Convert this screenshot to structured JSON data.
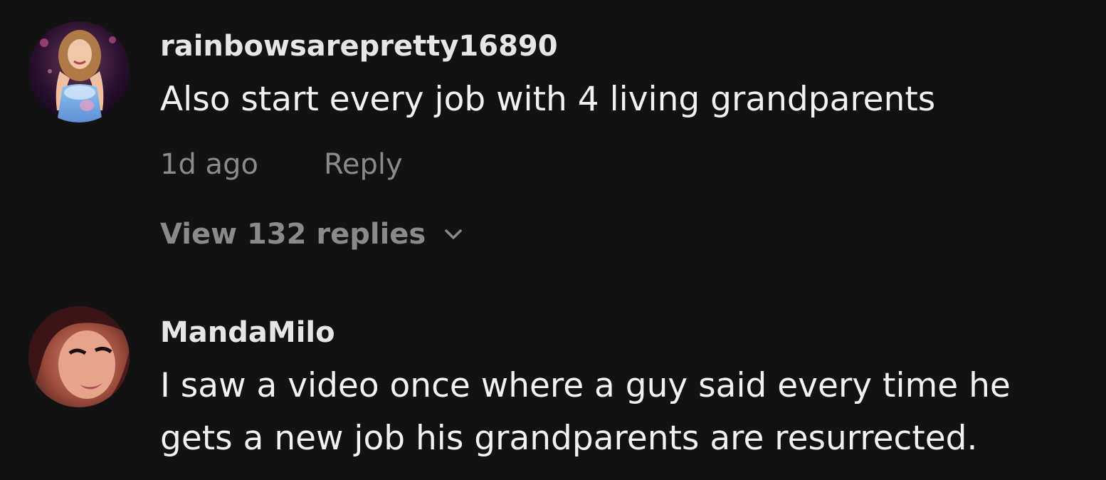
{
  "comments": [
    {
      "username": "rainbowsarepretty16890",
      "text": "Also start every job with 4 living grandparents",
      "time": "1d ago",
      "reply_label": "Reply",
      "view_replies_label": "View 132 replies",
      "avatar_icon": "user-avatar-photo"
    },
    {
      "username": "MandaMilo",
      "text_lines": [
        "I saw a video once where a guy said every time he",
        "gets a new job his grandparents are resurrected."
      ],
      "avatar_icon": "user-avatar-photo"
    }
  ],
  "colors": {
    "background": "#121212",
    "username": "#e6e6e6",
    "text": "#f2f2f2",
    "meta": "#8a8a8a"
  }
}
